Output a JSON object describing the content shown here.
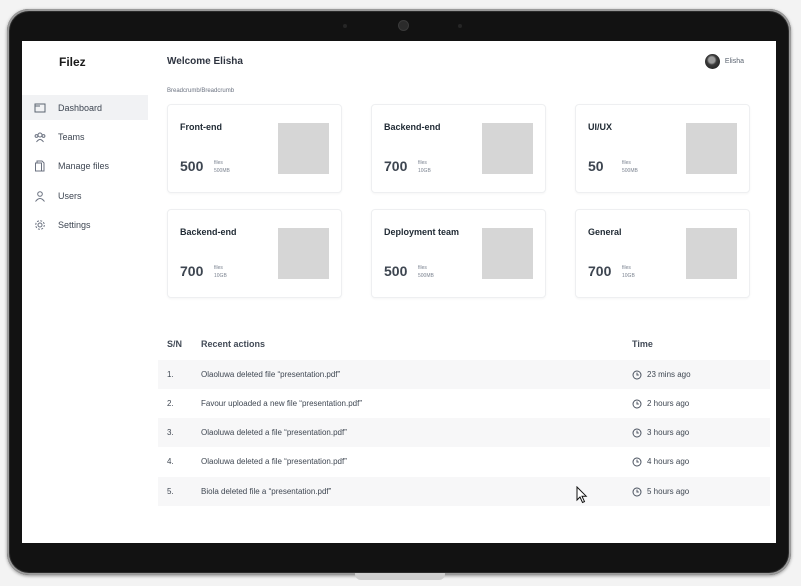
{
  "app": {
    "logo": "Filez"
  },
  "sidebar": {
    "items": [
      {
        "label": "Dashboard",
        "icon": "dashboard-icon",
        "active": true
      },
      {
        "label": "Teams",
        "icon": "teams-icon"
      },
      {
        "label": "Manage files",
        "icon": "files-icon"
      },
      {
        "label": "Users",
        "icon": "user-icon"
      },
      {
        "label": "Settings",
        "icon": "gear-icon"
      }
    ]
  },
  "header": {
    "welcome": "Welcome Elisha",
    "user_name": "Elisha"
  },
  "breadcrumb": "Breadcrumb/Breadcrumb",
  "cards": [
    {
      "title": "Front-end",
      "count": "500",
      "files_label": "files",
      "size": "500MB"
    },
    {
      "title": "Backend-end",
      "count": "700",
      "files_label": "files",
      "size": "10GB"
    },
    {
      "title": "UI/UX",
      "count": "50",
      "files_label": "files",
      "size": "500MB"
    },
    {
      "title": "Backend-end",
      "count": "700",
      "files_label": "files",
      "size": "10GB"
    },
    {
      "title": "Deployment team",
      "count": "500",
      "files_label": "files",
      "size": "500MB"
    },
    {
      "title": "General",
      "count": "700",
      "files_label": "files",
      "size": "10GB"
    }
  ],
  "table": {
    "headers": {
      "sn": "S/N",
      "action": "Recent actions",
      "time": "Time"
    },
    "rows": [
      {
        "sn": "1.",
        "action": "Olaoluwa deleted file “presentation.pdf”",
        "time": "23 mins ago"
      },
      {
        "sn": "2.",
        "action": "Favour uploaded a new file “presentation.pdf”",
        "time": "2 hours ago"
      },
      {
        "sn": "3.",
        "action": "Olaoluwa deleted a file “presentation.pdf”",
        "time": "3 hours ago"
      },
      {
        "sn": "4.",
        "action": "Olaoluwa deleted a file “presentation.pdf”",
        "time": "4 hours ago"
      },
      {
        "sn": "5.",
        "action": "Biola deleted file a “presentation.pdf”",
        "time": "5 hours ago"
      }
    ]
  }
}
